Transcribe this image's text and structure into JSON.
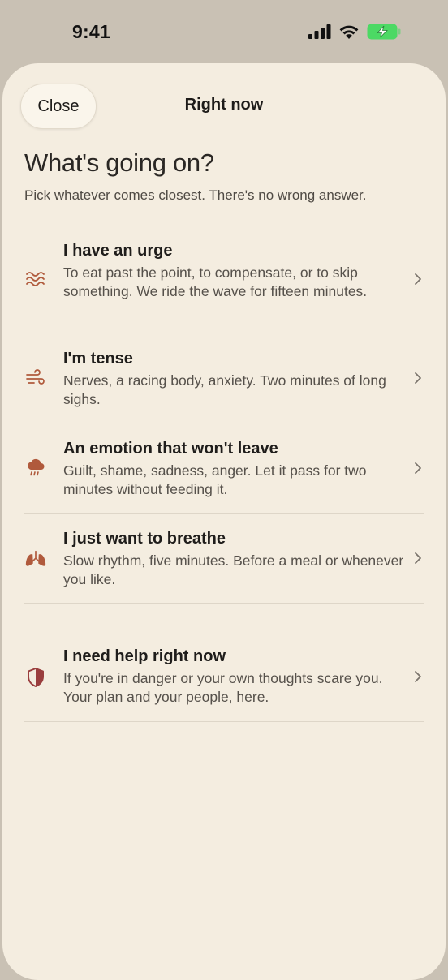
{
  "status_bar": {
    "time": "9:41"
  },
  "nav": {
    "close_label": "Close",
    "title": "Right now"
  },
  "header": {
    "title": "What's going on?",
    "subtitle": "Pick whatever comes closest. There's no wrong answer."
  },
  "options": [
    {
      "icon": "waves-icon",
      "title": "I have an urge",
      "description": "To eat past the point, to compensate, or to skip something. We ride the wave for fifteen minutes."
    },
    {
      "icon": "wind-icon",
      "title": "I'm tense",
      "description": "Nerves, a racing body, anxiety. Two minutes of long sighs."
    },
    {
      "icon": "rain-cloud-icon",
      "title": "An emotion that won't leave",
      "description": "Guilt, shame, sadness, anger. Let it pass for two minutes without feeding it."
    },
    {
      "icon": "lungs-icon",
      "title": "I just want to breathe",
      "description": "Slow rhythm, five minutes. Before a meal or whenever you like."
    },
    {
      "icon": "shield-icon",
      "title": "I need help right now",
      "description": "If you're in danger or your own thoughts scare you. Your plan and your people, here."
    }
  ],
  "colors": {
    "background": "#f4ede0",
    "accent_icon": "#b05a3c",
    "battery": "#4cd964"
  }
}
